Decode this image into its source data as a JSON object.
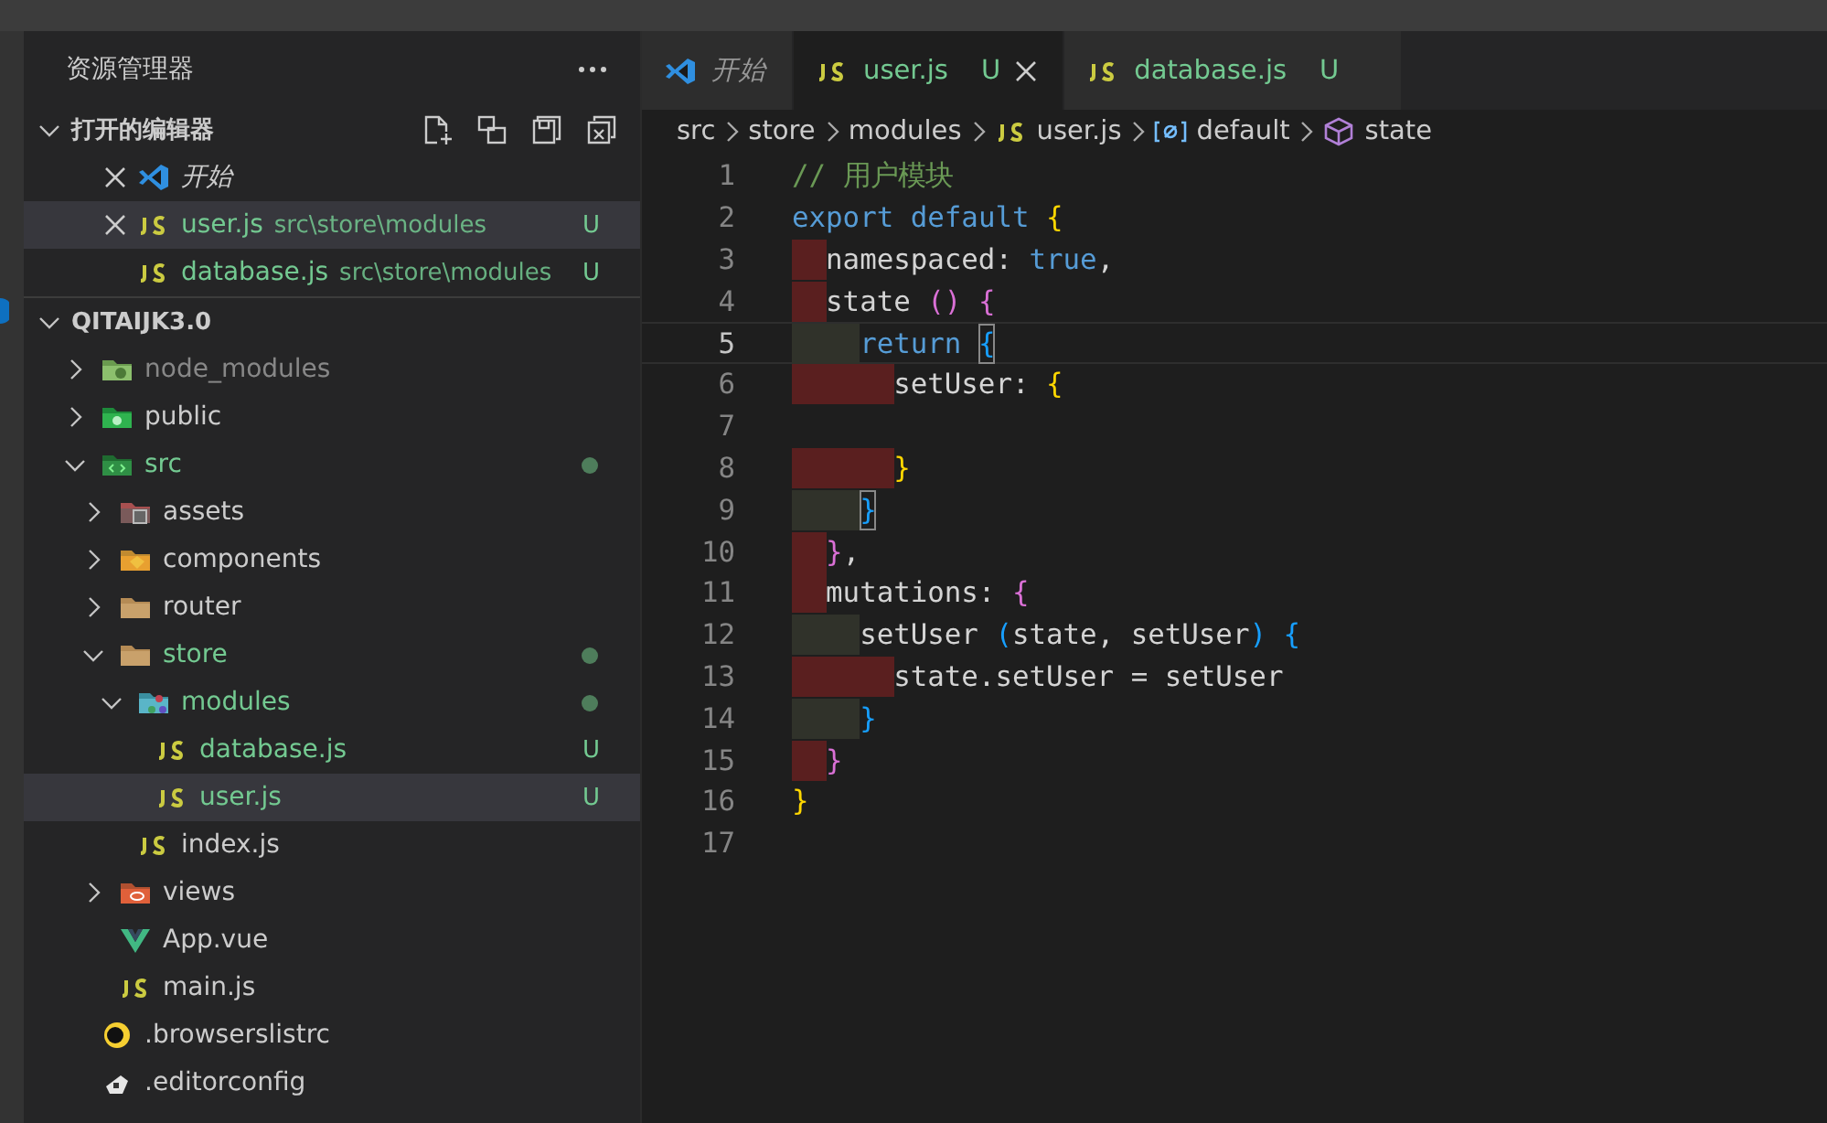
{
  "explorer": {
    "title": "资源管理器",
    "open_editors": {
      "title": "打开的编辑器",
      "expanded": true,
      "items": [
        {
          "name": "开始",
          "kind": "vscode",
          "preview": true,
          "close": true,
          "selected": false,
          "untracked": false
        },
        {
          "name": "user.js",
          "path": "src\\store\\modules",
          "kind": "js",
          "preview": false,
          "close": true,
          "selected": true,
          "untracked": true,
          "badge": "U"
        },
        {
          "name": "database.js",
          "path": "src\\store\\modules",
          "kind": "js",
          "preview": false,
          "close": false,
          "selected": false,
          "untracked": true,
          "badge": "U"
        }
      ]
    },
    "project": {
      "title": "QITAIJK3.0",
      "expanded": true,
      "tree": [
        {
          "name": "node_modules",
          "kind": "nodefolder",
          "expanded": false,
          "untracked": false,
          "ignored": true,
          "dot": false,
          "selected": false
        },
        {
          "name": "public",
          "kind": "publicfolder",
          "expanded": false,
          "untracked": false,
          "ignored": false,
          "dot": false,
          "selected": false
        },
        {
          "name": "src",
          "kind": "srcfolder",
          "expanded": true,
          "untracked": true,
          "ignored": false,
          "dot": true,
          "selected": false,
          "children": [
            {
              "name": "assets",
              "kind": "assetsfolder",
              "expanded": false,
              "untracked": false,
              "ignored": false,
              "dot": false,
              "selected": false
            },
            {
              "name": "components",
              "kind": "componentsfolder",
              "expanded": false,
              "untracked": false,
              "ignored": false,
              "dot": false,
              "selected": false
            },
            {
              "name": "router",
              "kind": "folder",
              "expanded": false,
              "untracked": false,
              "ignored": false,
              "dot": false,
              "selected": false
            },
            {
              "name": "store",
              "kind": "folder",
              "expanded": true,
              "untracked": true,
              "ignored": false,
              "dot": true,
              "selected": false,
              "children": [
                {
                  "name": "modules",
                  "kind": "modulesfolder",
                  "expanded": true,
                  "untracked": true,
                  "ignored": false,
                  "dot": true,
                  "selected": false,
                  "children": [
                    {
                      "name": "database.js",
                      "kind": "js",
                      "untracked": true,
                      "ignored": false,
                      "dot": false,
                      "badge": "U",
                      "selected": false
                    },
                    {
                      "name": "user.js",
                      "kind": "js",
                      "untracked": true,
                      "ignored": false,
                      "dot": false,
                      "badge": "U",
                      "selected": true
                    }
                  ]
                },
                {
                  "name": "index.js",
                  "kind": "js",
                  "untracked": false,
                  "ignored": false,
                  "dot": false,
                  "selected": false
                }
              ]
            },
            {
              "name": "views",
              "kind": "viewsfolder",
              "expanded": false,
              "untracked": false,
              "ignored": false,
              "dot": false,
              "selected": false
            },
            {
              "name": "App.vue",
              "kind": "vue",
              "untracked": false,
              "ignored": false,
              "dot": false,
              "selected": false
            },
            {
              "name": "main.js",
              "kind": "js",
              "untracked": false,
              "ignored": false,
              "dot": false,
              "selected": false
            }
          ]
        },
        {
          "name": ".browserslistrc",
          "kind": "browserslist",
          "untracked": false,
          "ignored": false,
          "dot": false,
          "selected": false
        },
        {
          "name": ".editorconfig",
          "kind": "editorconfig",
          "untracked": false,
          "ignored": false,
          "dot": false,
          "selected": false
        }
      ]
    }
  },
  "editor": {
    "tabs": [
      {
        "label": "开始",
        "kind": "vscode",
        "preview": true,
        "close": false,
        "selected": false,
        "untracked": false
      },
      {
        "label": "user.js",
        "kind": "js",
        "preview": false,
        "badge": "U",
        "close": true,
        "selected": true,
        "untracked": true
      },
      {
        "label": "database.js",
        "kind": "js",
        "preview": false,
        "badge": "U",
        "close": false,
        "selected": false,
        "untracked": true
      }
    ],
    "breadcrumb": [
      {
        "label": "src",
        "kind": "text"
      },
      {
        "label": "store",
        "kind": "text"
      },
      {
        "label": "modules",
        "kind": "text"
      },
      {
        "label": "user.js",
        "kind": "js"
      },
      {
        "label": "default",
        "kind": "variable"
      },
      {
        "label": "state",
        "kind": "cube"
      }
    ],
    "lines": [
      {
        "number": "1",
        "current": false,
        "tokens": [
          {
            "text": "// 用户模块",
            "kind": "comment"
          }
        ]
      },
      {
        "number": "2",
        "current": false,
        "tokens": [
          {
            "text": "export",
            "kind": "keyword"
          },
          {
            "text": " default",
            "kind": "keyword"
          },
          {
            "text": " {",
            "kind": "bracket1"
          }
        ]
      },
      {
        "number": "3",
        "current": false,
        "indent_error": true,
        "tokens": [
          {
            "text": "  namespaced: ",
            "kind": "plain"
          },
          {
            "text": "true",
            "kind": "keyword"
          },
          {
            "text": ",",
            "kind": "plain"
          }
        ]
      },
      {
        "number": "4",
        "current": false,
        "indent_error": true,
        "tokens": [
          {
            "text": "  state ",
            "kind": "plain"
          },
          {
            "text": "()",
            "kind": "bracket2"
          },
          {
            "text": " {",
            "kind": "bracket2"
          }
        ]
      },
      {
        "number": "5",
        "current": true,
        "indent_error": false,
        "tokens": [
          {
            "text": "    return ",
            "kind": "keyword"
          },
          {
            "text": "{",
            "kind": "bracket3",
            "matched": true
          }
        ]
      },
      {
        "number": "6",
        "current": false,
        "indent_error": true,
        "tokens": [
          {
            "text": "      setUser: ",
            "kind": "plain"
          },
          {
            "text": "{",
            "kind": "bracket1"
          }
        ]
      },
      {
        "number": "7",
        "current": false
      },
      {
        "number": "8",
        "current": false,
        "indent_error": true,
        "tokens": [
          {
            "text": "      }",
            "kind": "bracket1"
          }
        ]
      },
      {
        "number": "9",
        "current": false,
        "indent_error": false,
        "tokens": [
          {
            "text": "    }",
            "kind": "bracket3",
            "matched": true
          }
        ]
      },
      {
        "number": "10",
        "current": false,
        "indent_error": true,
        "tokens": [
          {
            "text": "  }",
            "kind": "bracket2"
          },
          {
            "text": ",",
            "kind": "plain"
          }
        ]
      },
      {
        "number": "11",
        "current": false,
        "indent_error": true,
        "tokens": [
          {
            "text": "  mutations: ",
            "kind": "plain"
          },
          {
            "text": "{",
            "kind": "bracket2"
          }
        ]
      },
      {
        "number": "12",
        "current": false,
        "indent_error": false,
        "tokens": [
          {
            "text": "    setUser ",
            "kind": "plain"
          },
          {
            "text": "(",
            "kind": "bracket3"
          },
          {
            "text": "state, setUser",
            "kind": "plain"
          },
          {
            "text": ")",
            "kind": "bracket3"
          },
          {
            "text": " {",
            "kind": "bracket3"
          }
        ]
      },
      {
        "number": "13",
        "current": false,
        "indent_error": true,
        "tokens": [
          {
            "text": "      state.setUser = setUser",
            "kind": "plain"
          }
        ]
      },
      {
        "number": "14",
        "current": false,
        "indent_error": false,
        "tokens": [
          {
            "text": "    }",
            "kind": "bracket3"
          }
        ]
      },
      {
        "number": "15",
        "current": false,
        "indent_error": true,
        "tokens": [
          {
            "text": "  }",
            "kind": "bracket2"
          }
        ]
      },
      {
        "number": "16",
        "current": false,
        "tokens": [
          {
            "text": "}",
            "kind": "bracket1"
          }
        ]
      },
      {
        "number": "17",
        "current": false
      }
    ]
  }
}
